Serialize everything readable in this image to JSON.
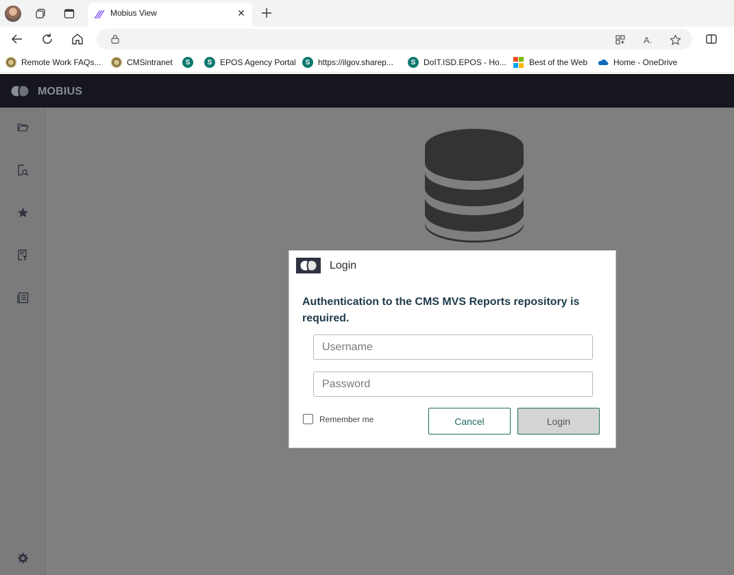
{
  "browser": {
    "tab": {
      "title": "Mobius View"
    },
    "favorites": [
      {
        "label": "Remote Work FAQs...",
        "icon": "seal-icon"
      },
      {
        "label": "CMSintranet",
        "icon": "seal-icon"
      },
      {
        "label": "",
        "icon": "sharepoint-icon"
      },
      {
        "label": "EPOS Agency Portal",
        "icon": "sharepoint-icon"
      },
      {
        "label": "https://ilgov.sharep...",
        "icon": "sharepoint-icon"
      },
      {
        "label": "DoIT.ISD.EPOS - Ho...",
        "icon": "sharepoint-icon"
      },
      {
        "label": "Best of the Web",
        "icon": "microsoft-icon"
      },
      {
        "label": "Home - OneDrive",
        "icon": "onedrive-icon"
      }
    ]
  },
  "app": {
    "brand": "MOBIUS",
    "sidebar": [
      "folder-icon",
      "search-document-icon",
      "star-icon",
      "filter-icon",
      "report-icon",
      "gear-icon"
    ]
  },
  "login": {
    "title": "Login",
    "message": "Authentication to the CMS MVS Reports repository is required.",
    "username_placeholder": "Username",
    "password_placeholder": "Password",
    "remember_label": "Remember me",
    "cancel_label": "Cancel",
    "login_label": "Login"
  },
  "colors": {
    "app_header": "#15161e",
    "overlay": "#7f7f7f",
    "accent": "#1e6a5e",
    "message_text": "#1d3a4a"
  }
}
